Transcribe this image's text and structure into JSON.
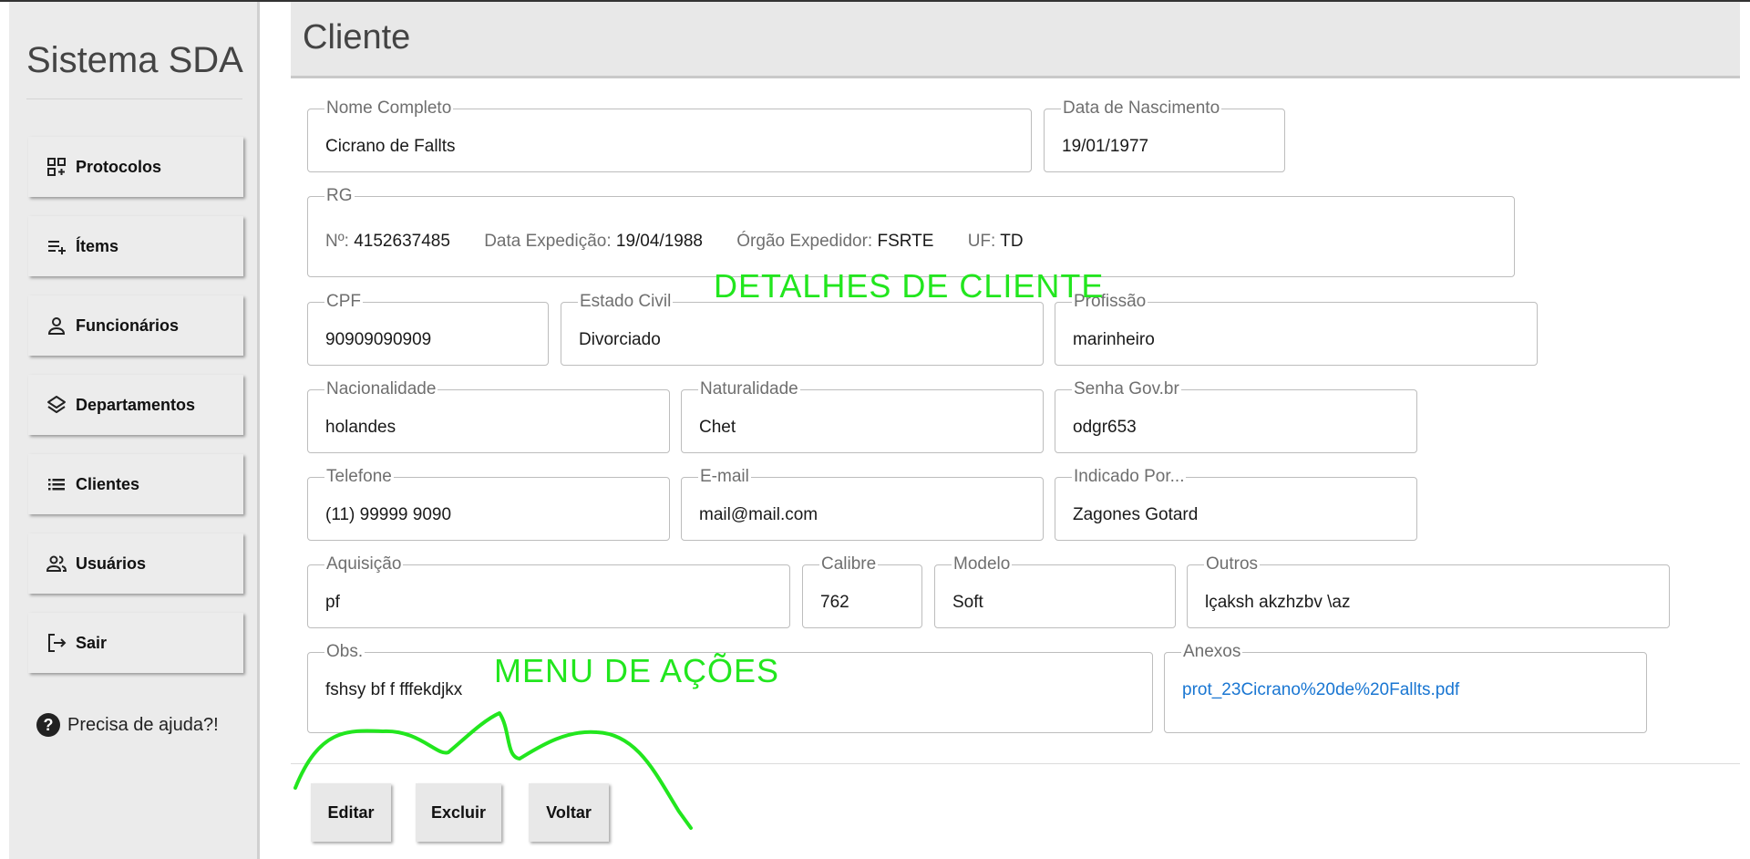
{
  "app": {
    "brand": "Sistema SDA"
  },
  "sidebar": {
    "items": [
      {
        "label": "Protocolos",
        "icon": "dashboard-add-icon"
      },
      {
        "label": "Ítems",
        "icon": "playlist-add-icon"
      },
      {
        "label": "Funcionários",
        "icon": "person-icon"
      },
      {
        "label": "Departamentos",
        "icon": "layers-icon"
      },
      {
        "label": "Clientes",
        "icon": "list-icon"
      },
      {
        "label": "Usuários",
        "icon": "people-icon"
      },
      {
        "label": "Sair",
        "icon": "logout-icon"
      }
    ],
    "help": "Precisa de ajuda?!"
  },
  "header": {
    "title": "Cliente"
  },
  "form": {
    "nome": {
      "label": "Nome Completo",
      "value": "Cicrano de Fallts"
    },
    "nascimento": {
      "label": "Data de Nascimento",
      "value": "19/01/1977"
    },
    "rg": {
      "label": "RG",
      "numero_label": "Nº:",
      "numero": "4152637485",
      "expedicao_label": "Data Expedição:",
      "expedicao": "19/04/1988",
      "orgao_label": "Órgão Expedidor:",
      "orgao": "FSRTE",
      "uf_label": "UF:",
      "uf": "TD"
    },
    "cpf": {
      "label": "CPF",
      "value": "90909090909"
    },
    "estado_civil": {
      "label": "Estado Civil",
      "value": "Divorciado"
    },
    "profissao": {
      "label": "Profissão",
      "value": "marinheiro"
    },
    "nacionalidade": {
      "label": "Nacionalidade",
      "value": "holandes"
    },
    "naturalidade": {
      "label": "Naturalidade",
      "value": "Chet"
    },
    "senha_gov": {
      "label": "Senha Gov.br",
      "value": "odgr653"
    },
    "telefone": {
      "label": "Telefone",
      "value": "(11) 99999 9090"
    },
    "email": {
      "label": "E-mail",
      "value": "mail@mail.com"
    },
    "indicado": {
      "label": "Indicado Por...",
      "value": "Zagones Gotard"
    },
    "aquisicao": {
      "label": "Aquisição",
      "value": "pf"
    },
    "calibre": {
      "label": "Calibre",
      "value": "762"
    },
    "modelo": {
      "label": "Modelo",
      "value": "Soft"
    },
    "outros": {
      "label": "Outros",
      "value": "lçaksh akzhzbv \\az"
    },
    "obs": {
      "label": "Obs.",
      "value": "fshsy bf f fffekdjkx"
    },
    "anexos": {
      "label": "Anexos",
      "value": "prot_23Cicrano%20de%20Fallts.pdf"
    }
  },
  "actions": {
    "edit": "Editar",
    "delete": "Excluir",
    "back": "Voltar"
  },
  "annotations": {
    "details": "DETALHES DE CLIENTE",
    "menu": "MENU DE AÇÕES",
    "color": "#22e61e"
  }
}
